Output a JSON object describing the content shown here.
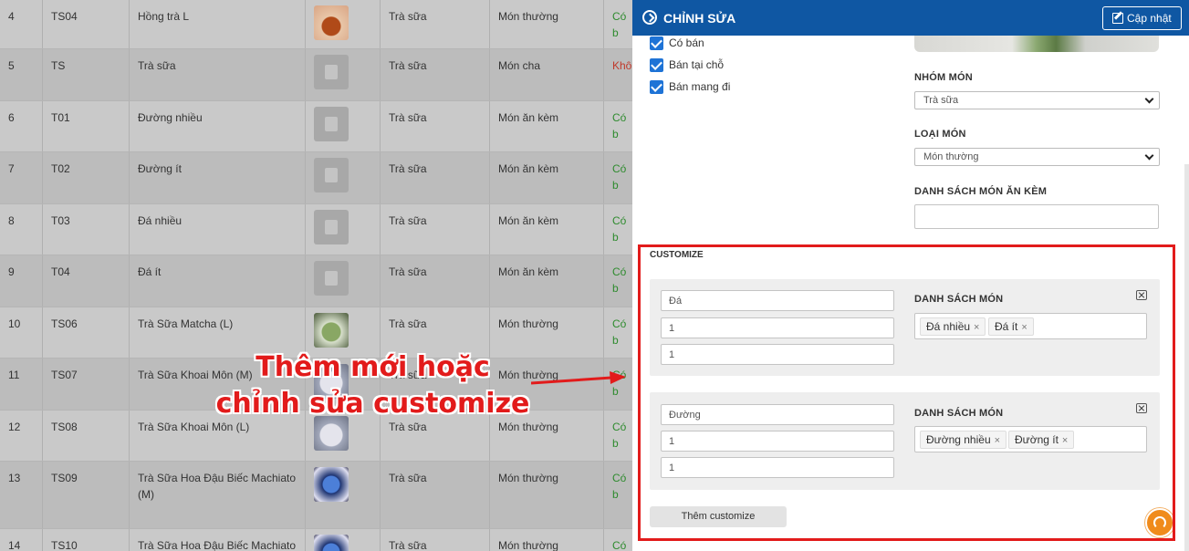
{
  "table": {
    "rows": [
      {
        "id": "4",
        "code": "TS04",
        "name": "Hồng trà L",
        "image": "img-1",
        "group": "Trà sữa",
        "type": "Món thường",
        "status": "Có b",
        "status_color": "green"
      },
      {
        "id": "5",
        "code": "TS",
        "name": "Trà sữa",
        "image": "placeholder",
        "group": "Trà sữa",
        "type": "Món cha",
        "status": "Khô",
        "status_color": "red"
      },
      {
        "id": "6",
        "code": "T01",
        "name": "Đường nhiều",
        "image": "placeholder",
        "group": "Trà sữa",
        "type": "Món ăn kèm",
        "status": "Có b",
        "status_color": "green"
      },
      {
        "id": "7",
        "code": "T02",
        "name": "Đường ít",
        "image": "placeholder",
        "group": "Trà sữa",
        "type": "Món ăn kèm",
        "status": "Có b",
        "status_color": "green"
      },
      {
        "id": "8",
        "code": "T03",
        "name": "Đá nhiều",
        "image": "placeholder",
        "group": "Trà sữa",
        "type": "Món ăn kèm",
        "status": "Có b",
        "status_color": "green"
      },
      {
        "id": "9",
        "code": "T04",
        "name": "Đá ít",
        "image": "placeholder",
        "group": "Trà sữa",
        "type": "Món ăn kèm",
        "status": "Có b",
        "status_color": "green"
      },
      {
        "id": "10",
        "code": "TS06",
        "name": "Trà Sữa Matcha (L)",
        "image": "img-2",
        "group": "Trà sữa",
        "type": "Món thường",
        "status": "Có b",
        "status_color": "green"
      },
      {
        "id": "11",
        "code": "TS07",
        "name": "Trà Sữa Khoai Môn (M)",
        "image": "img-3",
        "group": "Trà sữa",
        "type": "Món thường",
        "status": "Có b",
        "status_color": "green"
      },
      {
        "id": "12",
        "code": "TS08",
        "name": "Trà Sữa Khoai Môn (L)",
        "image": "img-3",
        "group": "Trà sữa",
        "type": "Món thường",
        "status": "Có b",
        "status_color": "green"
      },
      {
        "id": "13",
        "code": "TS09",
        "name": "Trà Sữa Hoa Đậu Biếc Machiato (M)",
        "image": "img-4",
        "group": "Trà sữa",
        "type": "Món thường",
        "status": "Có b",
        "status_color": "green"
      },
      {
        "id": "14",
        "code": "TS10",
        "name": "Trà Sữa Hoa Đậu Biếc Machiato",
        "image": "img-4",
        "group": "Trà sữa",
        "type": "Món thường",
        "status": "Có b",
        "status_color": "green"
      }
    ]
  },
  "panel": {
    "title": "CHỈNH SỬA",
    "update_label": "Cập nhật",
    "checkboxes": [
      {
        "label": "Có bán",
        "checked": true
      },
      {
        "label": "Bán tại chỗ",
        "checked": true
      },
      {
        "label": "Bán mang đi",
        "checked": true
      }
    ],
    "group_label": "NHÓM MÓN",
    "group_value": "Trà sữa",
    "type_label": "LOẠI MÓN",
    "type_value": "Món thường",
    "sides_label": "DANH SÁCH MÓN ĂN KÈM",
    "sides_value": ""
  },
  "customize": {
    "section_label": "CUSTOMIZE",
    "list_label": "DANH SÁCH MÓN",
    "groups": [
      {
        "name": "Đá",
        "field2": "1",
        "field3": "1",
        "items": [
          "Đá nhiều",
          "Đá ít"
        ]
      },
      {
        "name": "Đường",
        "field2": "1",
        "field3": "1",
        "items": [
          "Đường nhiều",
          "Đường ít"
        ]
      }
    ],
    "add_label": "Thêm customize",
    "remove_glyph": "×"
  },
  "annotation": {
    "line1": "Thêm mới hoặc",
    "line2": "chỉnh sửa customize",
    "color": "#e21b1b"
  },
  "colors": {
    "header_blue": "#0f57a3",
    "checkbox_blue": "#1e73d6",
    "status_green": "#2e8b2e",
    "status_red": "#c0392b",
    "support_orange": "#f08b1b"
  }
}
